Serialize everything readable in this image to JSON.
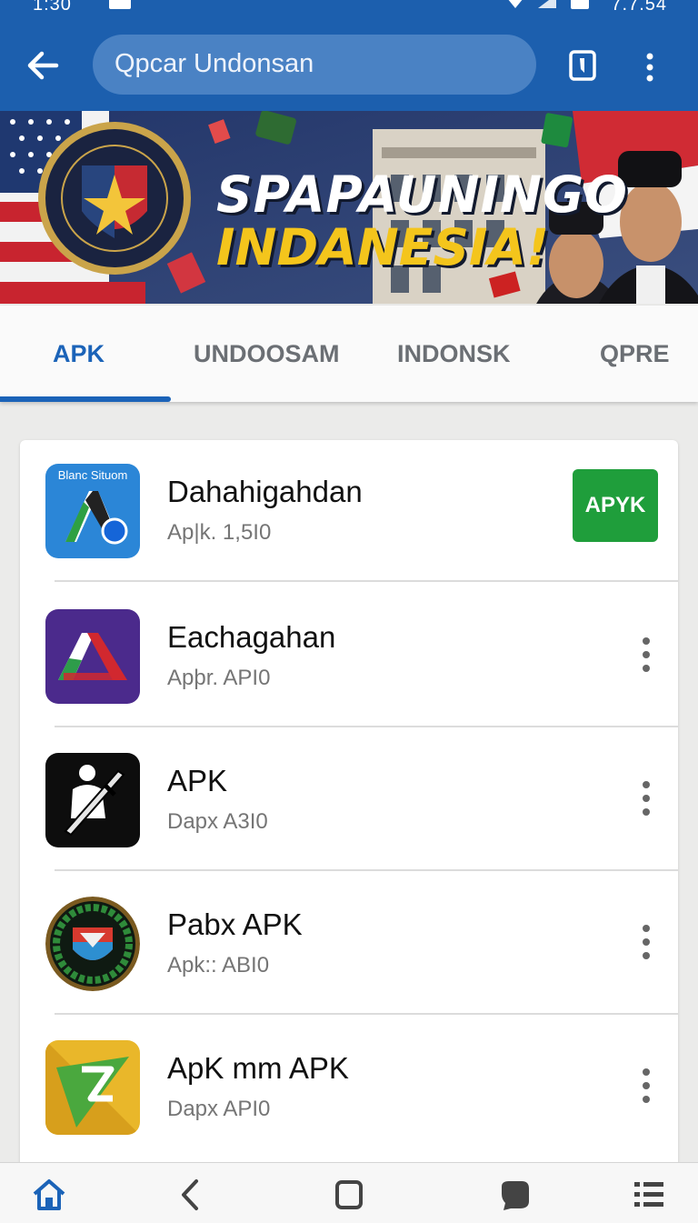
{
  "status_bar": {
    "time": "1:30",
    "right_text": "7.7.54"
  },
  "app_bar": {
    "search_text": "Qpcar Undonsan"
  },
  "banner": {
    "title_line1": "SPAPAUNINGO",
    "title_line2": "INDANESIA!",
    "badge_text_top": "UNDAEL DBDGEA",
    "badge_text_bottom": "OTE 72"
  },
  "tabs": [
    {
      "label": "APK",
      "active": true
    },
    {
      "label": "UNDOOSAM",
      "active": false
    },
    {
      "label": "INDONSK",
      "active": false
    },
    {
      "label": "QPRE",
      "active": false
    }
  ],
  "apps": [
    {
      "name": "Dahahigahdan",
      "sub": "Ap|k. 1,5I0",
      "icon": "stylized-a-blue-icon",
      "icon_caption": "Blanc Situom",
      "action": "install",
      "action_label": "APYK"
    },
    {
      "name": "Eachagahan",
      "sub": "Apþr. API0",
      "icon": "stylized-a-purple-icon",
      "action": "menu"
    },
    {
      "name": "APK",
      "sub": "Dapx A3I0",
      "icon": "soldier-sword-icon",
      "action": "menu"
    },
    {
      "name": "Pabx APK",
      "sub": "Apk:: ABI0",
      "icon": "shield-emblem-icon",
      "action": "menu"
    },
    {
      "name": "ApK mm APK",
      "sub": "Dapx API0",
      "icon": "yellow-z-arrow-icon",
      "action": "menu"
    }
  ],
  "nav_bar": [
    "home-icon",
    "back-icon",
    "recents-icon",
    "chat-icon",
    "list-icon"
  ],
  "colors": {
    "primary": "#1c5fae",
    "tab_active": "#1b63b8",
    "install": "#1f9e3b",
    "banner_yellow": "#f4c51c"
  }
}
